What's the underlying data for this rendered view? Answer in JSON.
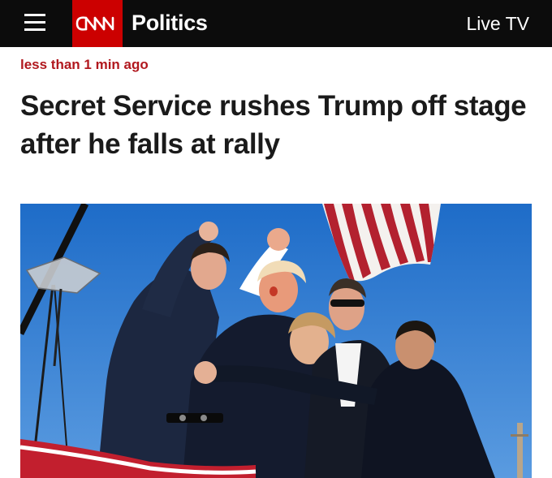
{
  "header": {
    "menu_icon": "hamburger-menu-icon",
    "logo_text": "CNN",
    "logo_color": "#cc0000",
    "section": "Politics",
    "live_tv": "Live TV"
  },
  "article": {
    "timestamp": "less than 1 min ago",
    "headline": "Secret Service rushes Trump off stage after he falls at rally",
    "timestamp_color": "#b1181e"
  },
  "photo": {
    "sky_color": "#2f7ad0"
  }
}
